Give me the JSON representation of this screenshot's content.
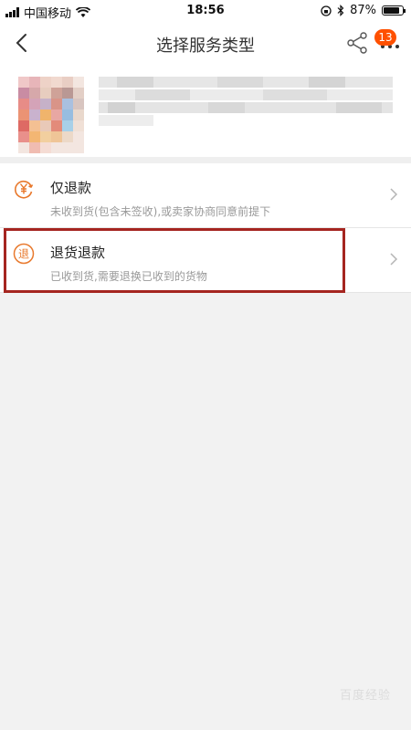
{
  "status_bar": {
    "carrier": "中国移动",
    "time": "18:56",
    "battery_percent": "87%",
    "battery_level": 0.87
  },
  "nav": {
    "title": "选择服务类型",
    "badge_count": "13",
    "back_icon": "back-chevron-icon",
    "share_icon": "share-icon",
    "more_icon": "more-dots-icon"
  },
  "options": [
    {
      "title": "仅退款",
      "desc": "未收到货(包含未签收),或卖家协商同意前提下",
      "icon": "yen-refund-icon",
      "color": "#e8782b"
    },
    {
      "title": "退货退款",
      "desc": "已收到货,需要退换已收到的货物",
      "icon": "return-goods-icon",
      "color": "#e8782b",
      "highlighted": true,
      "highlight_color": "#a52520"
    }
  ],
  "watermark": "百度经验",
  "colors": {
    "accent": "#ff5000",
    "icon": "#e8782b"
  }
}
